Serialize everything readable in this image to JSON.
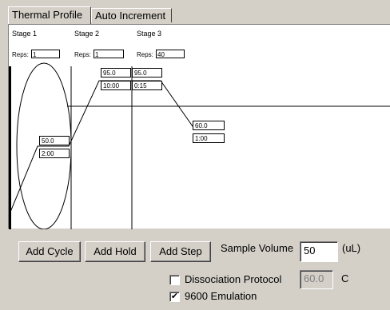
{
  "tabs": [
    {
      "label": "Thermal Profile",
      "active": true
    },
    {
      "label": "Auto Increment",
      "active": false
    }
  ],
  "stages": [
    {
      "label": "Stage 1",
      "reps_label": "Reps:",
      "reps": "1"
    },
    {
      "label": "Stage 2",
      "reps_label": "Reps:",
      "reps": "1"
    },
    {
      "label": "Stage 3",
      "reps_label": "Reps:",
      "reps": "40"
    }
  ],
  "steps": [
    {
      "temp": "50.0",
      "time": "2:00"
    },
    {
      "temp": "95.0",
      "time": "10:00"
    },
    {
      "temp": "95.0",
      "time": "0:15"
    },
    {
      "temp": "60.0",
      "time": "1:00"
    }
  ],
  "buttons": {
    "add_cycle": "Add Cycle",
    "add_hold": "Add Hold",
    "add_step": "Add Step"
  },
  "sample_volume": {
    "label": "Sample Volume",
    "value": "50",
    "unit": "(uL)"
  },
  "dissociation": {
    "label": "Dissociation Protocol",
    "checked": false,
    "value": "60.0",
    "unit": "C"
  },
  "emulation": {
    "label": "9600 Emulation",
    "checked": true,
    "check_glyph": "✔"
  }
}
